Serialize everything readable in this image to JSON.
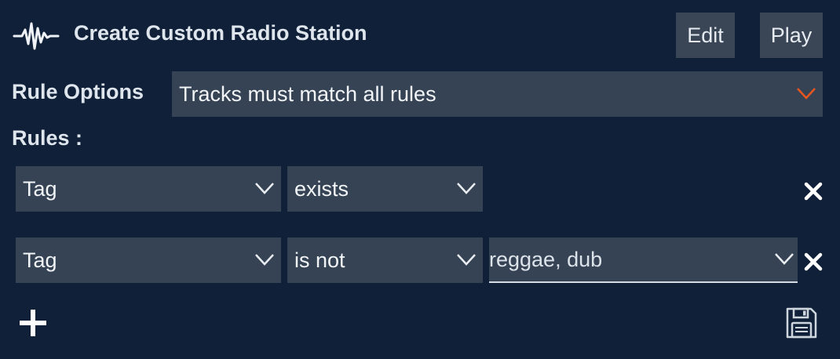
{
  "header": {
    "title": "Create Custom Radio Station",
    "icon": "waveform-icon",
    "edit_label": "Edit",
    "play_label": "Play"
  },
  "rule_options": {
    "label": "Rule Options",
    "selected": "Tracks must match all rules"
  },
  "rules": {
    "label": "Rules :",
    "items": [
      {
        "field": "Tag",
        "operator": "exists",
        "value": null
      },
      {
        "field": "Tag",
        "operator": "is not",
        "value": "reggae, dub"
      }
    ]
  },
  "actions": {
    "add_icon": "plus-icon",
    "save_icon": "floppy-disk-icon",
    "remove_icon": "close-icon"
  },
  "colors": {
    "background": "#0f2038",
    "control": "#364354",
    "button": "#3a4656",
    "accent_chevron": "#e8551f",
    "text": "#e9edf2"
  }
}
